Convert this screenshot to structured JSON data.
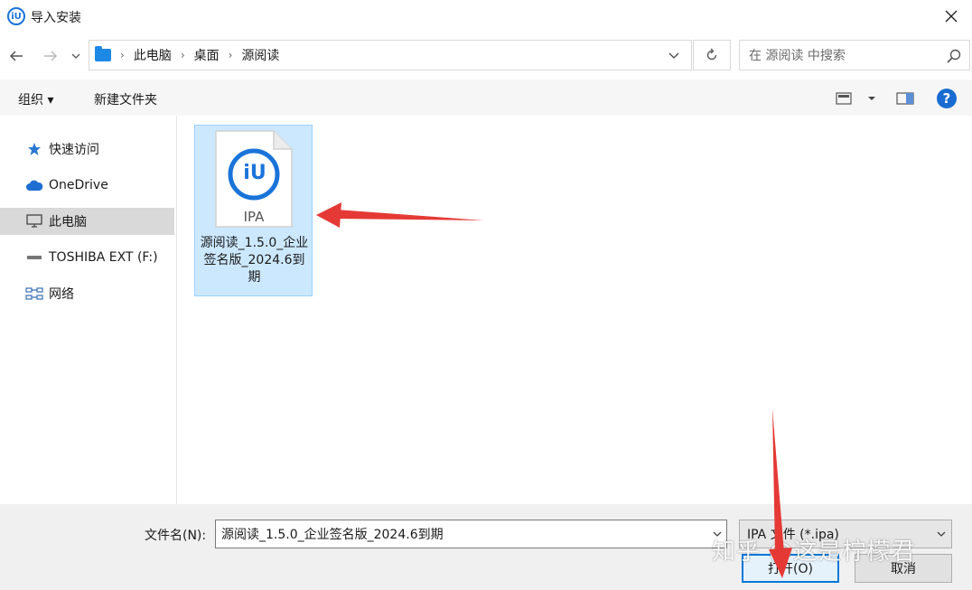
{
  "window": {
    "app_icon_text": "iU",
    "title": "导入安装"
  },
  "addressbar": {
    "crumbs": [
      "此电脑",
      "桌面",
      "源阅读"
    ]
  },
  "search": {
    "placeholder": "在 源阅读 中搜索"
  },
  "toolbar": {
    "organize_label": "组织 ▾",
    "new_folder_label": "新建文件夹"
  },
  "sidebar": {
    "items": [
      {
        "label": "快速访问",
        "icon": "star-icon"
      },
      {
        "label": "OneDrive",
        "icon": "cloud-icon"
      },
      {
        "label": "此电脑",
        "icon": "computer-icon",
        "selected": true
      },
      {
        "label": "TOSHIBA EXT (F:)",
        "icon": "drive-icon"
      },
      {
        "label": "网络",
        "icon": "network-icon"
      }
    ]
  },
  "files": [
    {
      "icon_logo": "iU",
      "icon_ext": "IPA",
      "name": "源阅读_1.5.0_企业签名版_2024.6到期"
    }
  ],
  "footer": {
    "filename_label": "文件名(N):",
    "filename_value": "源阅读_1.5.0_企业签名版_2024.6到期",
    "filetype_value": "IPA 文件 (*.ipa)",
    "open_label": "打开(O)",
    "cancel_label": "取消"
  },
  "watermark": "知乎 @这是柠檬君",
  "colors": {
    "accent": "#0078d7",
    "selection_bg": "#cce8ff",
    "annotation_arrow": "#e53935"
  }
}
